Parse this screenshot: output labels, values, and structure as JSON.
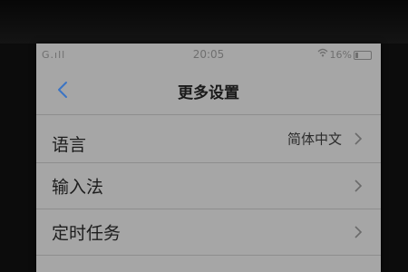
{
  "status": {
    "carrier": "G.ıll",
    "time": "20:05",
    "battery_text": "16%",
    "battery_level": 0.16
  },
  "nav": {
    "title": "更多设置",
    "back_icon": "chevron-left-icon"
  },
  "rows": [
    {
      "label": "语言",
      "value": "简体中文"
    },
    {
      "label": "输入法",
      "value": ""
    },
    {
      "label": "定时任务",
      "value": ""
    }
  ],
  "colors": {
    "accent": "#3b74c4",
    "screen_bg": "#a6a6a6"
  }
}
